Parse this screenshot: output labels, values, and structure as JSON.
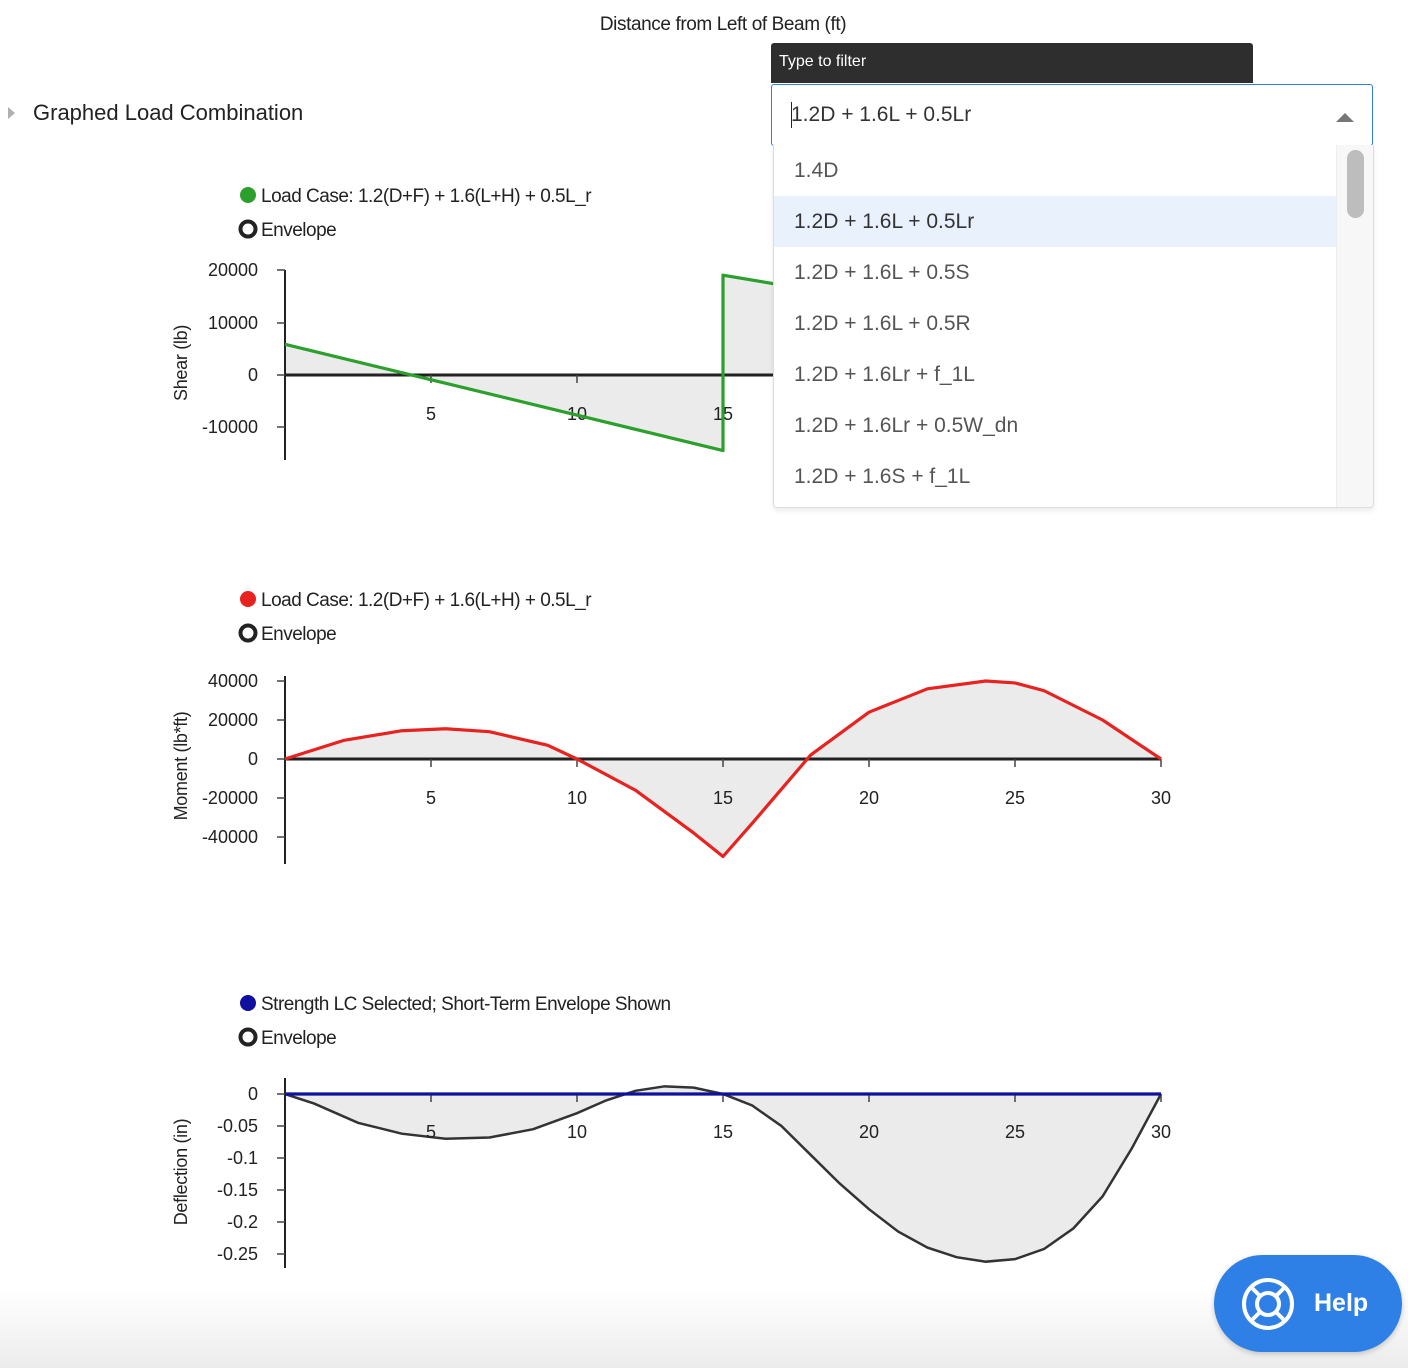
{
  "page": {
    "top_axis_title": "Distance from Left of Beam (ft)",
    "section_label": "Graphed Load Combination"
  },
  "dropdown": {
    "tooltip": "Type to filter",
    "selected_value": "1.2D + 1.6L + 0.5Lr",
    "options": [
      "1.4D",
      "1.2D + 1.6L + 0.5Lr",
      "1.2D + 1.6L + 0.5S",
      "1.2D + 1.6L + 0.5R",
      "1.2D + 1.6Lr + f_1L",
      "1.2D + 1.6Lr + 0.5W_dn",
      "1.2D + 1.6S + f_1L"
    ],
    "selected_index": 1
  },
  "help": {
    "label": "Help"
  },
  "chart_data": [
    {
      "type": "line",
      "ylabel": "Shear (lb)",
      "legend": [
        {
          "label": "Load Case: 1.2(D+F) + 1.6(L+H) + 0.5L_r",
          "color": "#2ca02c",
          "marker": "dot"
        },
        {
          "label": "Envelope",
          "color": "#222222",
          "marker": "ring"
        }
      ],
      "xlim": [
        0,
        30
      ],
      "ylim": [
        -16000,
        20000
      ],
      "xticks": [
        "5",
        "10",
        "15"
      ],
      "yticks": [
        "20000",
        "10000",
        "0",
        "-10000"
      ],
      "series": [
        {
          "name": "Load Case: 1.2(D+F) + 1.6(L+H) + 0.5L_r",
          "color": "#2ca02c",
          "x": [
            0,
            15,
            15,
            15,
            30
          ],
          "y": [
            5800,
            -14500,
            19000,
            19000,
            5000
          ]
        }
      ],
      "envelope": {
        "color": "#333333",
        "x": [
          0,
          15,
          15,
          30
        ],
        "y": [
          5800,
          -14500,
          19000,
          5000
        ]
      }
    },
    {
      "type": "line",
      "ylabel": "Moment (lb*ft)",
      "legend": [
        {
          "label": "Load Case: 1.2(D+F) + 1.6(L+H) + 0.5L_r",
          "color": "#e8221f",
          "marker": "dot"
        },
        {
          "label": "Envelope",
          "color": "#222222",
          "marker": "ring"
        }
      ],
      "xlim": [
        0,
        30
      ],
      "ylim": [
        -50000,
        45000
      ],
      "xticks": [
        "5",
        "10",
        "15",
        "20",
        "25",
        "30"
      ],
      "yticks": [
        "40000",
        "20000",
        "0",
        "-20000",
        "-40000"
      ],
      "series": [
        {
          "name": "Load Case: 1.2(D+F) + 1.6(L+H) + 0.5L_r",
          "color": "#e8221f",
          "x": [
            0,
            2,
            4,
            5.5,
            7,
            9,
            10,
            12,
            14,
            15,
            16,
            18,
            20,
            22,
            24,
            25,
            26,
            28,
            30
          ],
          "y": [
            0,
            9500,
            14500,
            15500,
            14000,
            7000,
            0,
            -16000,
            -38000,
            -50000,
            -33000,
            2000,
            24000,
            36000,
            40000,
            39000,
            35000,
            20000,
            0
          ]
        }
      ]
    },
    {
      "type": "line",
      "ylabel": "Deflection (in)",
      "legend": [
        {
          "label": "Strength LC Selected; Short-Term Envelope Shown",
          "color": "#1010a0",
          "marker": "dot"
        },
        {
          "label": "Envelope",
          "color": "#222222",
          "marker": "ring"
        }
      ],
      "xlim": [
        0,
        30
      ],
      "ylim": [
        -0.27,
        0.02
      ],
      "xticks": [
        "5",
        "10",
        "15",
        "20",
        "25",
        "30"
      ],
      "yticks": [
        "0",
        "-0.05",
        "-0.1",
        "-0.15",
        "-0.2",
        "-0.25"
      ],
      "series": [
        {
          "name": "Strength LC Selected; Short-Term Envelope Shown",
          "color": "#1010a0",
          "x": [
            0,
            30
          ],
          "y": [
            0,
            0
          ]
        }
      ],
      "envelope": {
        "color": "#333333",
        "x": [
          0,
          1,
          2.5,
          4,
          5.5,
          7,
          8.5,
          10,
          11,
          12,
          13,
          14,
          15,
          16,
          17,
          18,
          19,
          20,
          21,
          22,
          23,
          24,
          25,
          26,
          27,
          28,
          29,
          30
        ],
        "y": [
          0,
          -0.015,
          -0.045,
          -0.062,
          -0.07,
          -0.068,
          -0.055,
          -0.03,
          -0.01,
          0.005,
          0.012,
          0.01,
          0,
          -0.018,
          -0.05,
          -0.095,
          -0.14,
          -0.18,
          -0.215,
          -0.24,
          -0.255,
          -0.262,
          -0.258,
          -0.242,
          -0.21,
          -0.16,
          -0.085,
          0
        ]
      }
    }
  ]
}
